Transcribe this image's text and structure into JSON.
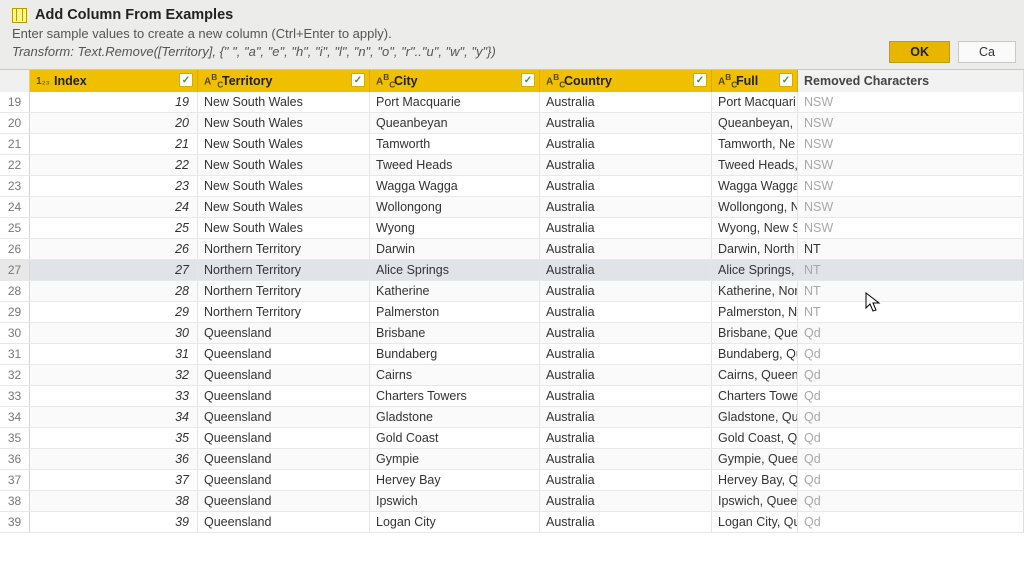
{
  "header": {
    "title": "Add Column From Examples",
    "subtitle": "Enter sample values to create a new column (Ctrl+Enter to apply).",
    "formula": "Transform: Text.Remove([Territory], {\" \", \"a\", \"e\", \"h\", \"i\", \"l\", \"n\", \"o\", \"r\"..\"u\", \"w\", \"y\"})",
    "ok": "OK",
    "cancel": "Ca"
  },
  "columns": {
    "index": {
      "label": "Index",
      "typeGlyph": "1"
    },
    "territory": {
      "label": "Territory",
      "typeGlyph": "A"
    },
    "city": {
      "label": "City",
      "typeGlyph": "A"
    },
    "country": {
      "label": "Country",
      "typeGlyph": "A"
    },
    "full": {
      "label": "Full",
      "typeGlyph": "A"
    },
    "newcol": {
      "label": "Removed Characters"
    }
  },
  "rows": [
    {
      "n": 19,
      "idx": 19,
      "terr": "New South Wales",
      "city": "Port Macquarie",
      "ctry": "Australia",
      "full": "Port Macquari",
      "new": "NSW",
      "user": false
    },
    {
      "n": 20,
      "idx": 20,
      "terr": "New South Wales",
      "city": "Queanbeyan",
      "ctry": "Australia",
      "full": "Queanbeyan, N",
      "new": "NSW",
      "user": false
    },
    {
      "n": 21,
      "idx": 21,
      "terr": "New South Wales",
      "city": "Tamworth",
      "ctry": "Australia",
      "full": "Tamworth, Ne",
      "new": "NSW",
      "user": false
    },
    {
      "n": 22,
      "idx": 22,
      "terr": "New South Wales",
      "city": "Tweed Heads",
      "ctry": "Australia",
      "full": "Tweed Heads,",
      "new": "NSW",
      "user": false
    },
    {
      "n": 23,
      "idx": 23,
      "terr": "New South Wales",
      "city": "Wagga Wagga",
      "ctry": "Australia",
      "full": "Wagga Wagga,",
      "new": "NSW",
      "user": false
    },
    {
      "n": 24,
      "idx": 24,
      "terr": "New South Wales",
      "city": "Wollongong",
      "ctry": "Australia",
      "full": "Wollongong, N",
      "new": "NSW",
      "user": false
    },
    {
      "n": 25,
      "idx": 25,
      "terr": "New South Wales",
      "city": "Wyong",
      "ctry": "Australia",
      "full": "Wyong, New S",
      "new": "NSW",
      "user": false
    },
    {
      "n": 26,
      "idx": 26,
      "terr": "Northern Territory",
      "city": "Darwin",
      "ctry": "Australia",
      "full": "Darwin, North",
      "new": "NT",
      "user": true
    },
    {
      "n": 27,
      "idx": 27,
      "terr": "Northern Territory",
      "city": "Alice Springs",
      "ctry": "Australia",
      "full": "Alice Springs, N",
      "new": "NT",
      "user": false,
      "hi": true
    },
    {
      "n": 28,
      "idx": 28,
      "terr": "Northern Territory",
      "city": "Katherine",
      "ctry": "Australia",
      "full": "Katherine, Nor",
      "new": "NT",
      "user": false
    },
    {
      "n": 29,
      "idx": 29,
      "terr": "Northern Territory",
      "city": "Palmerston",
      "ctry": "Australia",
      "full": "Palmerston, N",
      "new": "NT",
      "user": false
    },
    {
      "n": 30,
      "idx": 30,
      "terr": "Queensland",
      "city": "Brisbane",
      "ctry": "Australia",
      "full": "Brisbane, Que",
      "new": "Qd",
      "user": false
    },
    {
      "n": 31,
      "idx": 31,
      "terr": "Queensland",
      "city": "Bundaberg",
      "ctry": "Australia",
      "full": "Bundaberg, Qu",
      "new": "Qd",
      "user": false
    },
    {
      "n": 32,
      "idx": 32,
      "terr": "Queensland",
      "city": "Cairns",
      "ctry": "Australia",
      "full": "Cairns, Queens",
      "new": "Qd",
      "user": false
    },
    {
      "n": 33,
      "idx": 33,
      "terr": "Queensland",
      "city": "Charters Towers",
      "ctry": "Australia",
      "full": "Charters Towe",
      "new": "Qd",
      "user": false
    },
    {
      "n": 34,
      "idx": 34,
      "terr": "Queensland",
      "city": "Gladstone",
      "ctry": "Australia",
      "full": "Gladstone, Qu",
      "new": "Qd",
      "user": false
    },
    {
      "n": 35,
      "idx": 35,
      "terr": "Queensland",
      "city": "Gold Coast",
      "ctry": "Australia",
      "full": "Gold Coast, Qu",
      "new": "Qd",
      "user": false
    },
    {
      "n": 36,
      "idx": 36,
      "terr": "Queensland",
      "city": "Gympie",
      "ctry": "Australia",
      "full": "Gympie, Quee",
      "new": "Qd",
      "user": false
    },
    {
      "n": 37,
      "idx": 37,
      "terr": "Queensland",
      "city": "Hervey Bay",
      "ctry": "Australia",
      "full": "Hervey Bay, Qu",
      "new": "Qd",
      "user": false
    },
    {
      "n": 38,
      "idx": 38,
      "terr": "Queensland",
      "city": "Ipswich",
      "ctry": "Australia",
      "full": "Ipswich, Queen",
      "new": "Qd",
      "user": false
    },
    {
      "n": 39,
      "idx": 39,
      "terr": "Queensland",
      "city": "Logan City",
      "ctry": "Australia",
      "full": "Logan City, Qu",
      "new": "Qd",
      "user": false
    }
  ]
}
